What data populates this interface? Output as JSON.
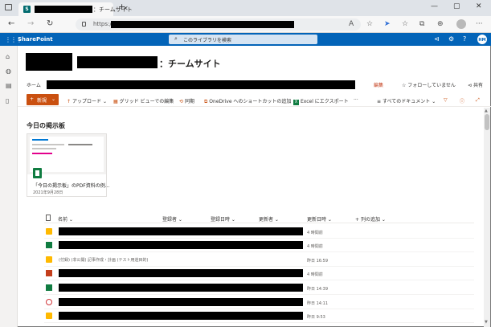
{
  "browser": {
    "tab_title": "：チームサイト",
    "url_protocol": "https://",
    "new_tab_symbol": "+",
    "close_symbol": "✕"
  },
  "suite": {
    "app_name": "SharePoint",
    "search_placeholder": "このライブラリを検索",
    "user_initials": "HM",
    "color": "#0364b8"
  },
  "site": {
    "title": "：チームサイト",
    "nav": {
      "home": "ホーム",
      "edit": "編集",
      "follow": "フォローしていません",
      "share": "共有"
    }
  },
  "commands": {
    "new": "新規",
    "upload": "アップロード",
    "grid_edit": "グリッド ビューでの編集",
    "sync": "同期",
    "onedrive_shortcut": "OneDrive へのショートカットの追加",
    "excel_export": "Excel にエクスポート",
    "more": "···",
    "view": "すべてのドキュメント"
  },
  "highlights": {
    "title": "今日の掲示板",
    "card": {
      "name": "「今日の掲示板」のPDF資料の例...",
      "date": "2021年9月28日"
    }
  },
  "list": {
    "columns": {
      "name": "名前",
      "created": "登録者",
      "created_at": "登録日時",
      "modified_by": "更新者",
      "modified": "更新日時",
      "add_column": "列の追加"
    },
    "rows": [
      {
        "type": "folder",
        "modified": "4 時間前",
        "name_text": ""
      },
      {
        "type": "xl",
        "modified": "4 時間前",
        "name_text": ""
      },
      {
        "type": "folder",
        "modified": "昨日 16:59",
        "name_text": "(付録) (非公開) 記事作成・計画 (テスト用途目的)"
      },
      {
        "type": "pp",
        "modified": "4 時間前",
        "name_text": ""
      },
      {
        "type": "xl",
        "modified": "昨日 14:39",
        "name_text": ""
      },
      {
        "type": "pdf",
        "modified": "昨日 14:11",
        "name_text": ""
      },
      {
        "type": "folder",
        "modified": "昨日 9:53",
        "name_text": ""
      }
    ]
  },
  "colors": {
    "accent": "#ca5010",
    "excel": "#107c41",
    "folder": "#ffb900"
  }
}
